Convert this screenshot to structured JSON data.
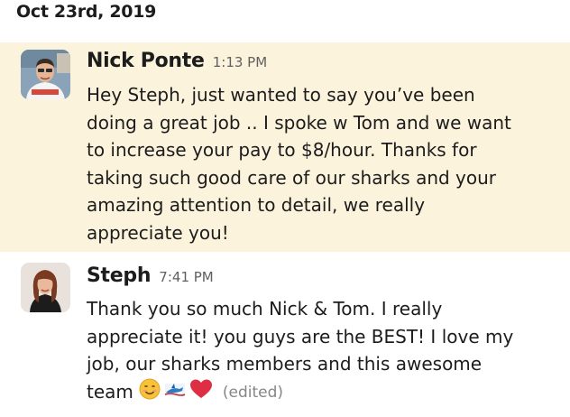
{
  "date_header": "Oct 23rd, 2019",
  "messages": [
    {
      "sender": "Nick Ponte",
      "time": "1:13 PM",
      "highlighted": true,
      "highlight_color": "#fbf3dc",
      "lines": [
        "Hey Steph, just wanted to say you’ve been",
        "doing a great job .. I spoke w Tom and we want",
        "to increase your pay to $8/hour. Thanks for",
        "taking such good care of our sharks and your",
        "amazing attention to detail, we really",
        "appreciate you!"
      ]
    },
    {
      "sender": "Steph",
      "time": "7:41 PM",
      "highlighted": false,
      "lines": [
        "Thank you so much Nick & Tom. I really",
        "appreciate it! you guys are the BEST! I love my",
        "job, our sharks members and this awesome",
        "team"
      ],
      "emojis": [
        "smiling-face-emoji",
        "custom-shark-emoji",
        "red-heart-emoji"
      ],
      "edited_label": "(edited)"
    }
  ]
}
